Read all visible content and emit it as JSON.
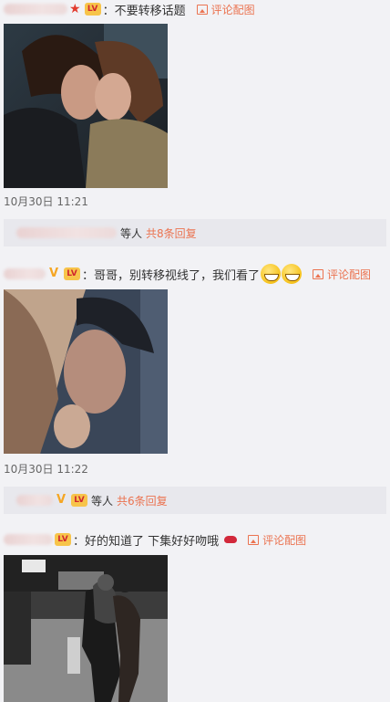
{
  "comments": [
    {
      "text": "：不要转移话题",
      "pic_link": "评论配图",
      "time": "10月30日 11:21",
      "reply_suffix": "等人",
      "reply_count": "共8条回复"
    },
    {
      "text": "：哥哥，别转移视线了，我们看了",
      "pic_link": "评论配图",
      "time": "10月30日 11:22",
      "reply_suffix": "等人",
      "reply_count": "共6条回复"
    },
    {
      "text": "：好的知道了 下集好好吻哦",
      "pic_link": "评论配图"
    }
  ],
  "icons": {
    "pic": "image-icon",
    "vip": "v-badge-icon",
    "star": "star-icon",
    "level": "level-badge-icon",
    "emoji": "grin-emoji-icon",
    "lips": "lips-emoji-icon"
  },
  "colors": {
    "accent": "#eb7350",
    "background": "#f2f2f5",
    "reply_bar": "#e8e8ed"
  }
}
